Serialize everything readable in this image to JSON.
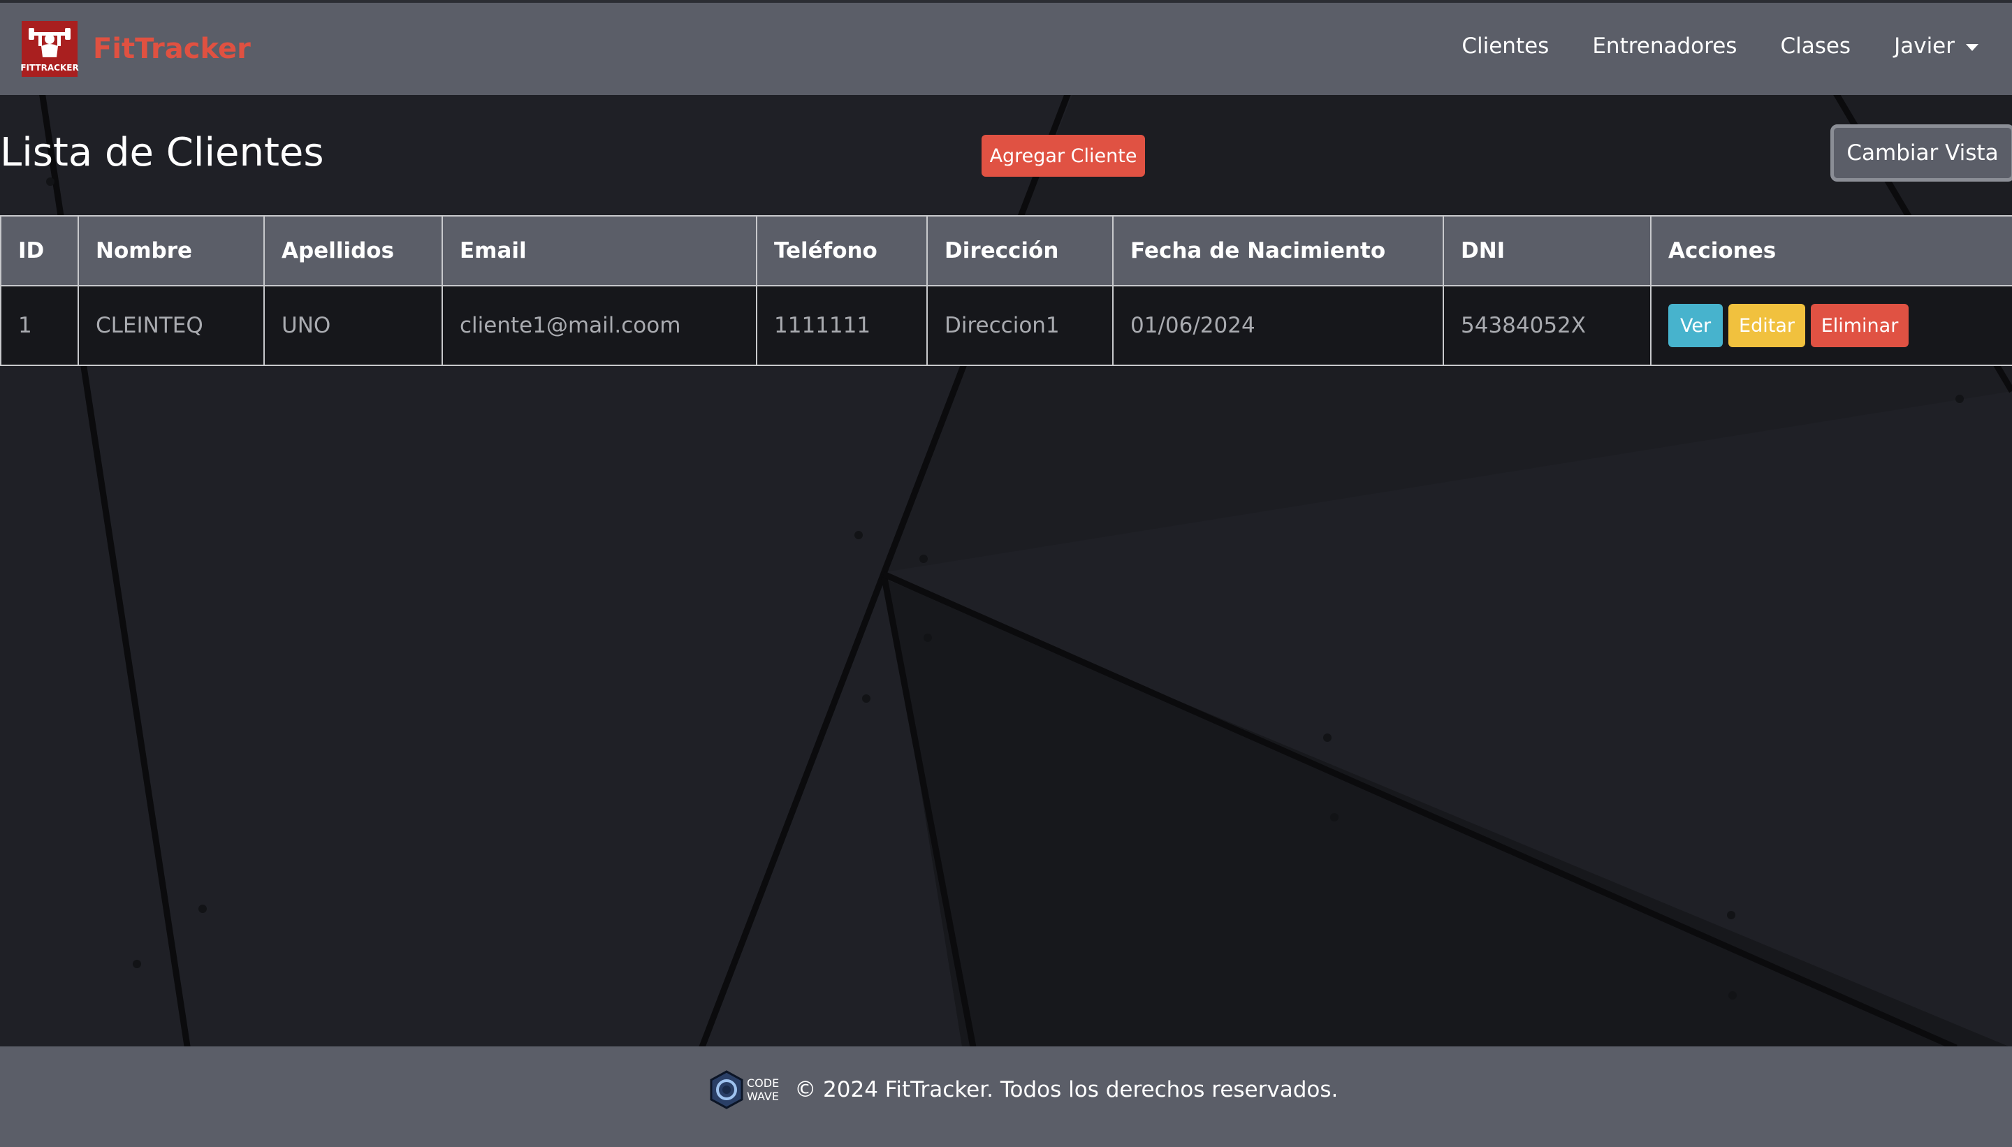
{
  "nav": {
    "brand": "FitTracker",
    "logo_text": "FITTRACKER",
    "links": [
      "Clientes",
      "Entrenadores",
      "Clases"
    ],
    "user": "Javier"
  },
  "page": {
    "title": "Lista de Clientes",
    "add_button": "Agregar Cliente",
    "toggle_view_button": "Cambiar Vista"
  },
  "table": {
    "headers": [
      "ID",
      "Nombre",
      "Apellidos",
      "Email",
      "Teléfono",
      "Dirección",
      "Fecha de Nacimiento",
      "DNI",
      "Acciones"
    ],
    "rows": [
      {
        "id": "1",
        "nombre": "CLEINTEQ",
        "apellidos": "UNO",
        "email": "cliente1@mail.coom",
        "telefono": "1111111",
        "direccion": "Direccion1",
        "fecha_nacimiento": "01/06/2024",
        "dni": "54384052X"
      }
    ],
    "actions": {
      "view": "Ver",
      "edit": "Editar",
      "delete": "Eliminar"
    }
  },
  "footer": {
    "logo_line1": "CODE",
    "logo_line2": "WAVE",
    "copyright": "© 2024 FitTracker. Todos los derechos reservados."
  },
  "colors": {
    "navbar": "#5b5e68",
    "brand": "#e05141",
    "danger": "#e05243",
    "info": "#47b3cd",
    "warning": "#f1c13e",
    "background": "#1e1f24"
  }
}
